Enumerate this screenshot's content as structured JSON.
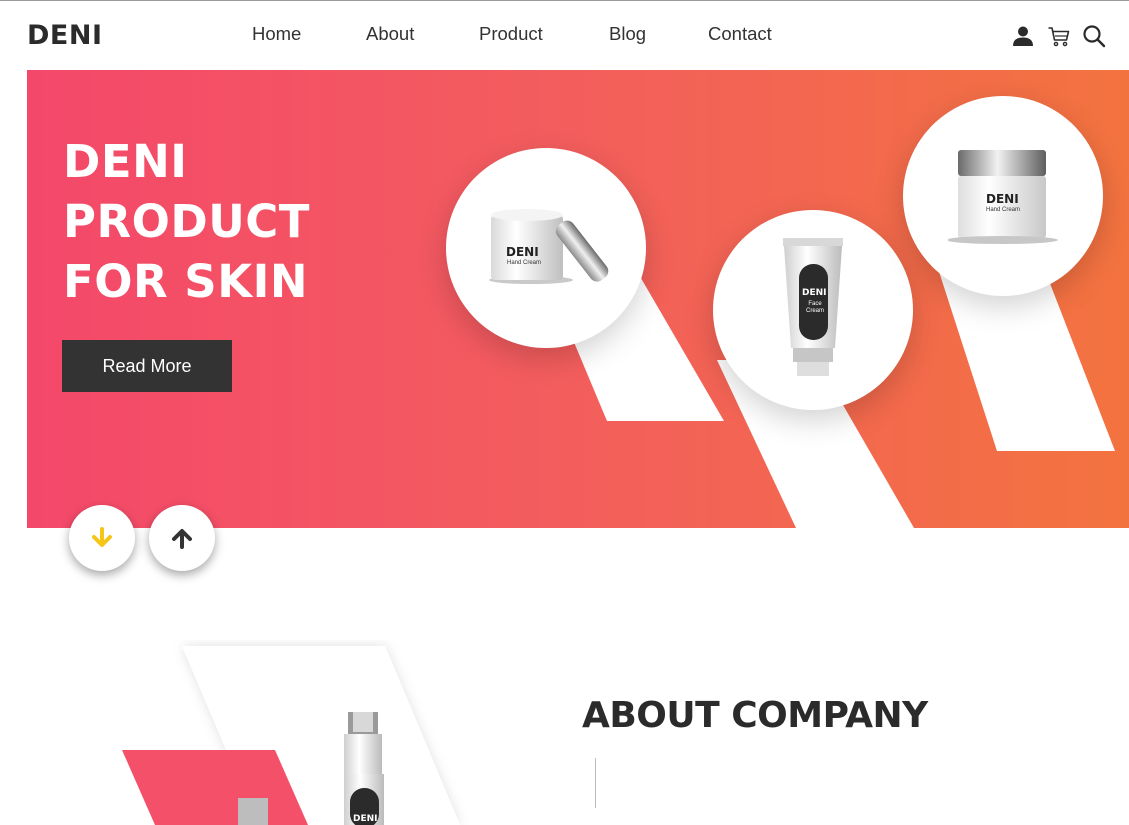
{
  "brand": {
    "logo": "DENI"
  },
  "nav": {
    "items": [
      {
        "label": "Home"
      },
      {
        "label": "About"
      },
      {
        "label": "Product"
      },
      {
        "label": "Blog"
      },
      {
        "label": "Contact"
      }
    ]
  },
  "header_icons": [
    "user-icon",
    "cart-icon",
    "search-icon"
  ],
  "hero": {
    "title_lines": [
      "DENI",
      "PRODUCT",
      "FOR SKIN"
    ],
    "cta_label": "Read More",
    "products": [
      {
        "brand": "DENI",
        "name": "Hand Cream"
      },
      {
        "brand": "DENI",
        "name": "Face Cream"
      },
      {
        "brand": "DENI",
        "name": "Hand Cream"
      }
    ],
    "scroll_buttons": [
      "arrow-down-icon",
      "arrow-up-icon"
    ]
  },
  "about": {
    "title": "ABOUT COMPANY",
    "product_brand": "DENI"
  },
  "colors": {
    "accent_start": "#f4486a",
    "accent_end": "#f3733f",
    "dark": "#333333",
    "arrow_down": "#f5c518"
  }
}
